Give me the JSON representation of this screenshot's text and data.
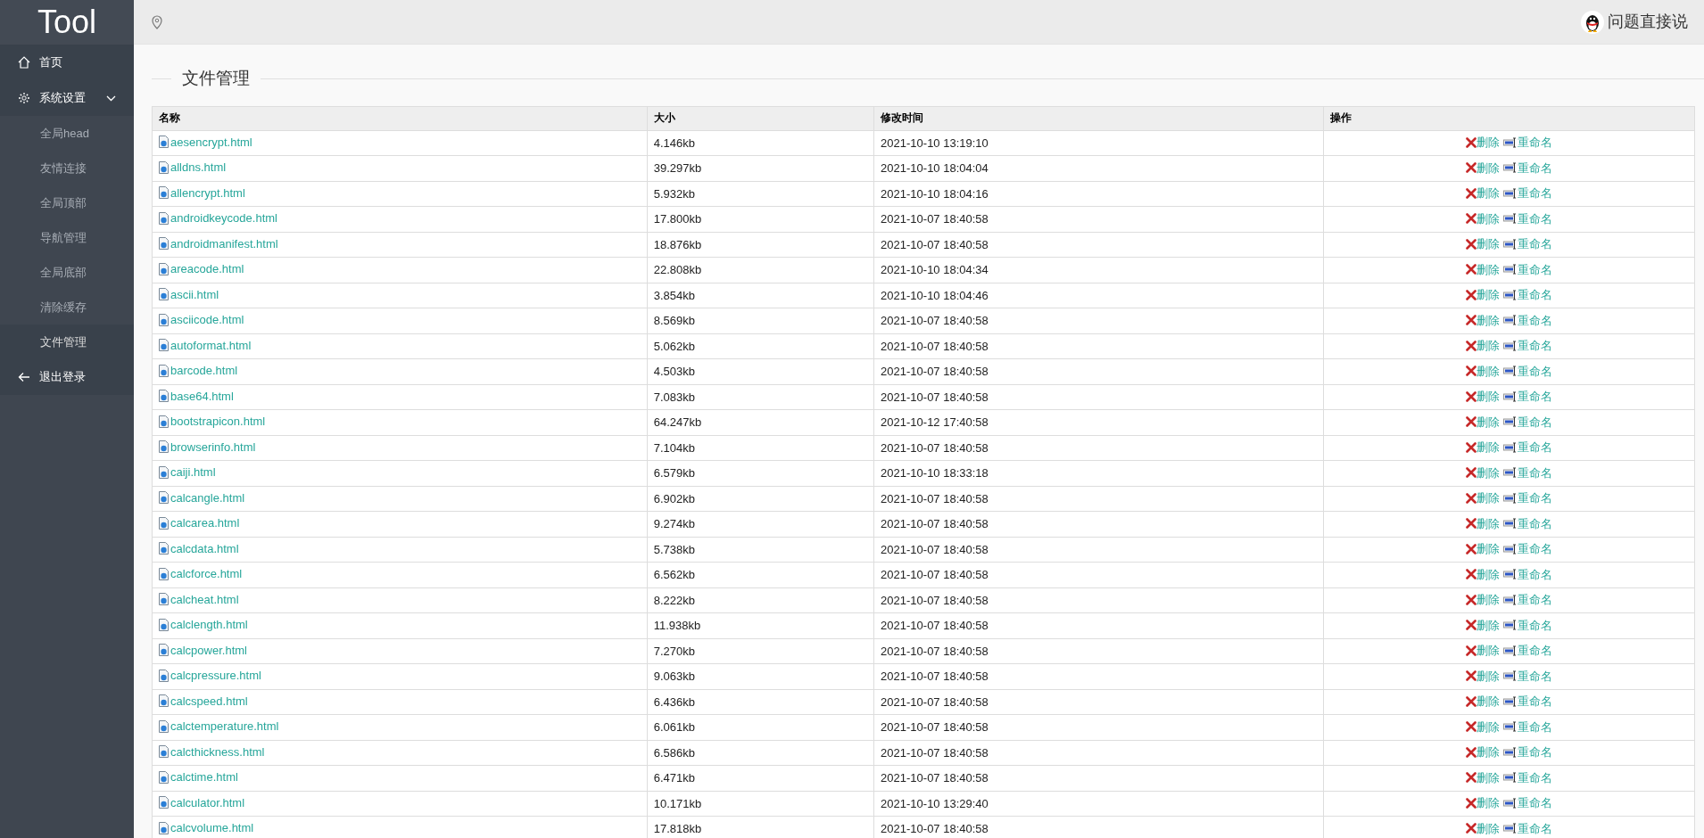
{
  "sidebar": {
    "logo": "Tool",
    "items": [
      {
        "kind": "home",
        "label": "首页",
        "selected": false
      },
      {
        "kind": "group",
        "label": "系统设置",
        "expanded": true,
        "children": [
          {
            "label": "全局head",
            "selected": false
          },
          {
            "label": "友情连接",
            "selected": false
          },
          {
            "label": "全局顶部",
            "selected": false
          },
          {
            "label": "导航管理",
            "selected": false
          },
          {
            "label": "全局底部",
            "selected": false
          },
          {
            "label": "清除缓存",
            "selected": false
          },
          {
            "label": "文件管理",
            "selected": true
          }
        ]
      },
      {
        "kind": "logout",
        "label": "退出登录",
        "selected": false
      }
    ]
  },
  "header": {
    "feedback": "问题直接说"
  },
  "section_title": "文件管理",
  "table": {
    "columns": [
      "名称",
      "大小",
      "修改时间",
      "操作"
    ],
    "rows": [
      {
        "name": "aesencrypt.html",
        "size": "4.146kb",
        "modified": "2021-10-10 13:19:10",
        "delete": "删除",
        "rename": "重命名"
      },
      {
        "name": "alldns.html",
        "size": "39.297kb",
        "modified": "2021-10-10 18:04:04",
        "delete": "删除",
        "rename": "重命名"
      },
      {
        "name": "allencrypt.html",
        "size": "5.932kb",
        "modified": "2021-10-10 18:04:16",
        "delete": "删除",
        "rename": "重命名"
      },
      {
        "name": "androidkeycode.html",
        "size": "17.800kb",
        "modified": "2021-10-07 18:40:58",
        "delete": "删除",
        "rename": "重命名"
      },
      {
        "name": "androidmanifest.html",
        "size": "18.876kb",
        "modified": "2021-10-07 18:40:58",
        "delete": "删除",
        "rename": "重命名"
      },
      {
        "name": "areacode.html",
        "size": "22.808kb",
        "modified": "2021-10-10 18:04:34",
        "delete": "删除",
        "rename": "重命名"
      },
      {
        "name": "ascii.html",
        "size": "3.854kb",
        "modified": "2021-10-10 18:04:46",
        "delete": "删除",
        "rename": "重命名"
      },
      {
        "name": "asciicode.html",
        "size": "8.569kb",
        "modified": "2021-10-07 18:40:58",
        "delete": "删除",
        "rename": "重命名"
      },
      {
        "name": "autoformat.html",
        "size": "5.062kb",
        "modified": "2021-10-07 18:40:58",
        "delete": "删除",
        "rename": "重命名"
      },
      {
        "name": "barcode.html",
        "size": "4.503kb",
        "modified": "2021-10-07 18:40:58",
        "delete": "删除",
        "rename": "重命名"
      },
      {
        "name": "base64.html",
        "size": "7.083kb",
        "modified": "2021-10-07 18:40:58",
        "delete": "删除",
        "rename": "重命名"
      },
      {
        "name": "bootstrapicon.html",
        "size": "64.247kb",
        "modified": "2021-10-12 17:40:58",
        "delete": "删除",
        "rename": "重命名"
      },
      {
        "name": "browserinfo.html",
        "size": "7.104kb",
        "modified": "2021-10-07 18:40:58",
        "delete": "删除",
        "rename": "重命名"
      },
      {
        "name": "caiji.html",
        "size": "6.579kb",
        "modified": "2021-10-10 18:33:18",
        "delete": "删除",
        "rename": "重命名"
      },
      {
        "name": "calcangle.html",
        "size": "6.902kb",
        "modified": "2021-10-07 18:40:58",
        "delete": "删除",
        "rename": "重命名"
      },
      {
        "name": "calcarea.html",
        "size": "9.274kb",
        "modified": "2021-10-07 18:40:58",
        "delete": "删除",
        "rename": "重命名"
      },
      {
        "name": "calcdata.html",
        "size": "5.738kb",
        "modified": "2021-10-07 18:40:58",
        "delete": "删除",
        "rename": "重命名"
      },
      {
        "name": "calcforce.html",
        "size": "6.562kb",
        "modified": "2021-10-07 18:40:58",
        "delete": "删除",
        "rename": "重命名"
      },
      {
        "name": "calcheat.html",
        "size": "8.222kb",
        "modified": "2021-10-07 18:40:58",
        "delete": "删除",
        "rename": "重命名"
      },
      {
        "name": "calclength.html",
        "size": "11.938kb",
        "modified": "2021-10-07 18:40:58",
        "delete": "删除",
        "rename": "重命名"
      },
      {
        "name": "calcpower.html",
        "size": "7.270kb",
        "modified": "2021-10-07 18:40:58",
        "delete": "删除",
        "rename": "重命名"
      },
      {
        "name": "calcpressure.html",
        "size": "9.063kb",
        "modified": "2021-10-07 18:40:58",
        "delete": "删除",
        "rename": "重命名"
      },
      {
        "name": "calcspeed.html",
        "size": "6.436kb",
        "modified": "2021-10-07 18:40:58",
        "delete": "删除",
        "rename": "重命名"
      },
      {
        "name": "calctemperature.html",
        "size": "6.061kb",
        "modified": "2021-10-07 18:40:58",
        "delete": "删除",
        "rename": "重命名"
      },
      {
        "name": "calcthickness.html",
        "size": "6.586kb",
        "modified": "2021-10-07 18:40:58",
        "delete": "删除",
        "rename": "重命名"
      },
      {
        "name": "calctime.html",
        "size": "6.471kb",
        "modified": "2021-10-07 18:40:58",
        "delete": "删除",
        "rename": "重命名"
      },
      {
        "name": "calculator.html",
        "size": "10.171kb",
        "modified": "2021-10-10 13:29:40",
        "delete": "删除",
        "rename": "重命名"
      },
      {
        "name": "calcvolume.html",
        "size": "17.818kb",
        "modified": "2021-10-07 18:40:58",
        "delete": "删除",
        "rename": "重命名"
      }
    ]
  }
}
